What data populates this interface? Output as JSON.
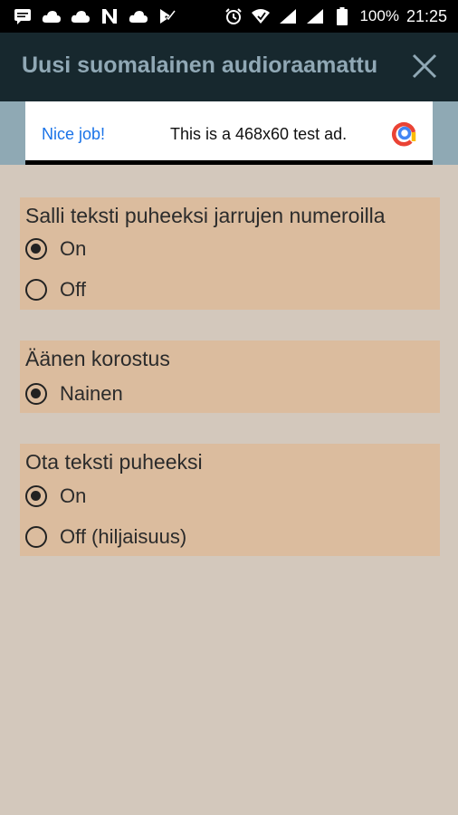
{
  "status_bar": {
    "battery_percent": "100%",
    "time": "21:25",
    "left_icons": [
      "message-icon",
      "cloud-icon",
      "cloud-icon",
      "n-icon",
      "cloud-icon",
      "check-icon"
    ],
    "right_icons": [
      "alarm-icon",
      "wifi-icon",
      "signal-icon",
      "signal-icon",
      "battery-icon"
    ]
  },
  "header": {
    "title": "Uusi suomalainen audioraamattu",
    "close_icon": "close-icon"
  },
  "ad": {
    "nice_label": "Nice job!",
    "text": "This is a 468x60 test ad."
  },
  "sections": [
    {
      "title": "Salli teksti puheeksi jarrujen numeroilla",
      "options": [
        {
          "label": "On",
          "checked": true
        },
        {
          "label": "Off",
          "checked": false
        }
      ]
    },
    {
      "title": "Äänen korostus",
      "options": [
        {
          "label": "Nainen",
          "checked": true
        }
      ]
    },
    {
      "title": "Ota teksti puheeksi",
      "options": [
        {
          "label": "On",
          "checked": true
        },
        {
          "label": "Off (hiljaisuus)",
          "checked": false
        }
      ]
    }
  ],
  "colors": {
    "background": "#d3c8bc",
    "section_bg": "#dbbc9e",
    "header_bg": "#17282e",
    "title_color": "#90a8b5"
  }
}
